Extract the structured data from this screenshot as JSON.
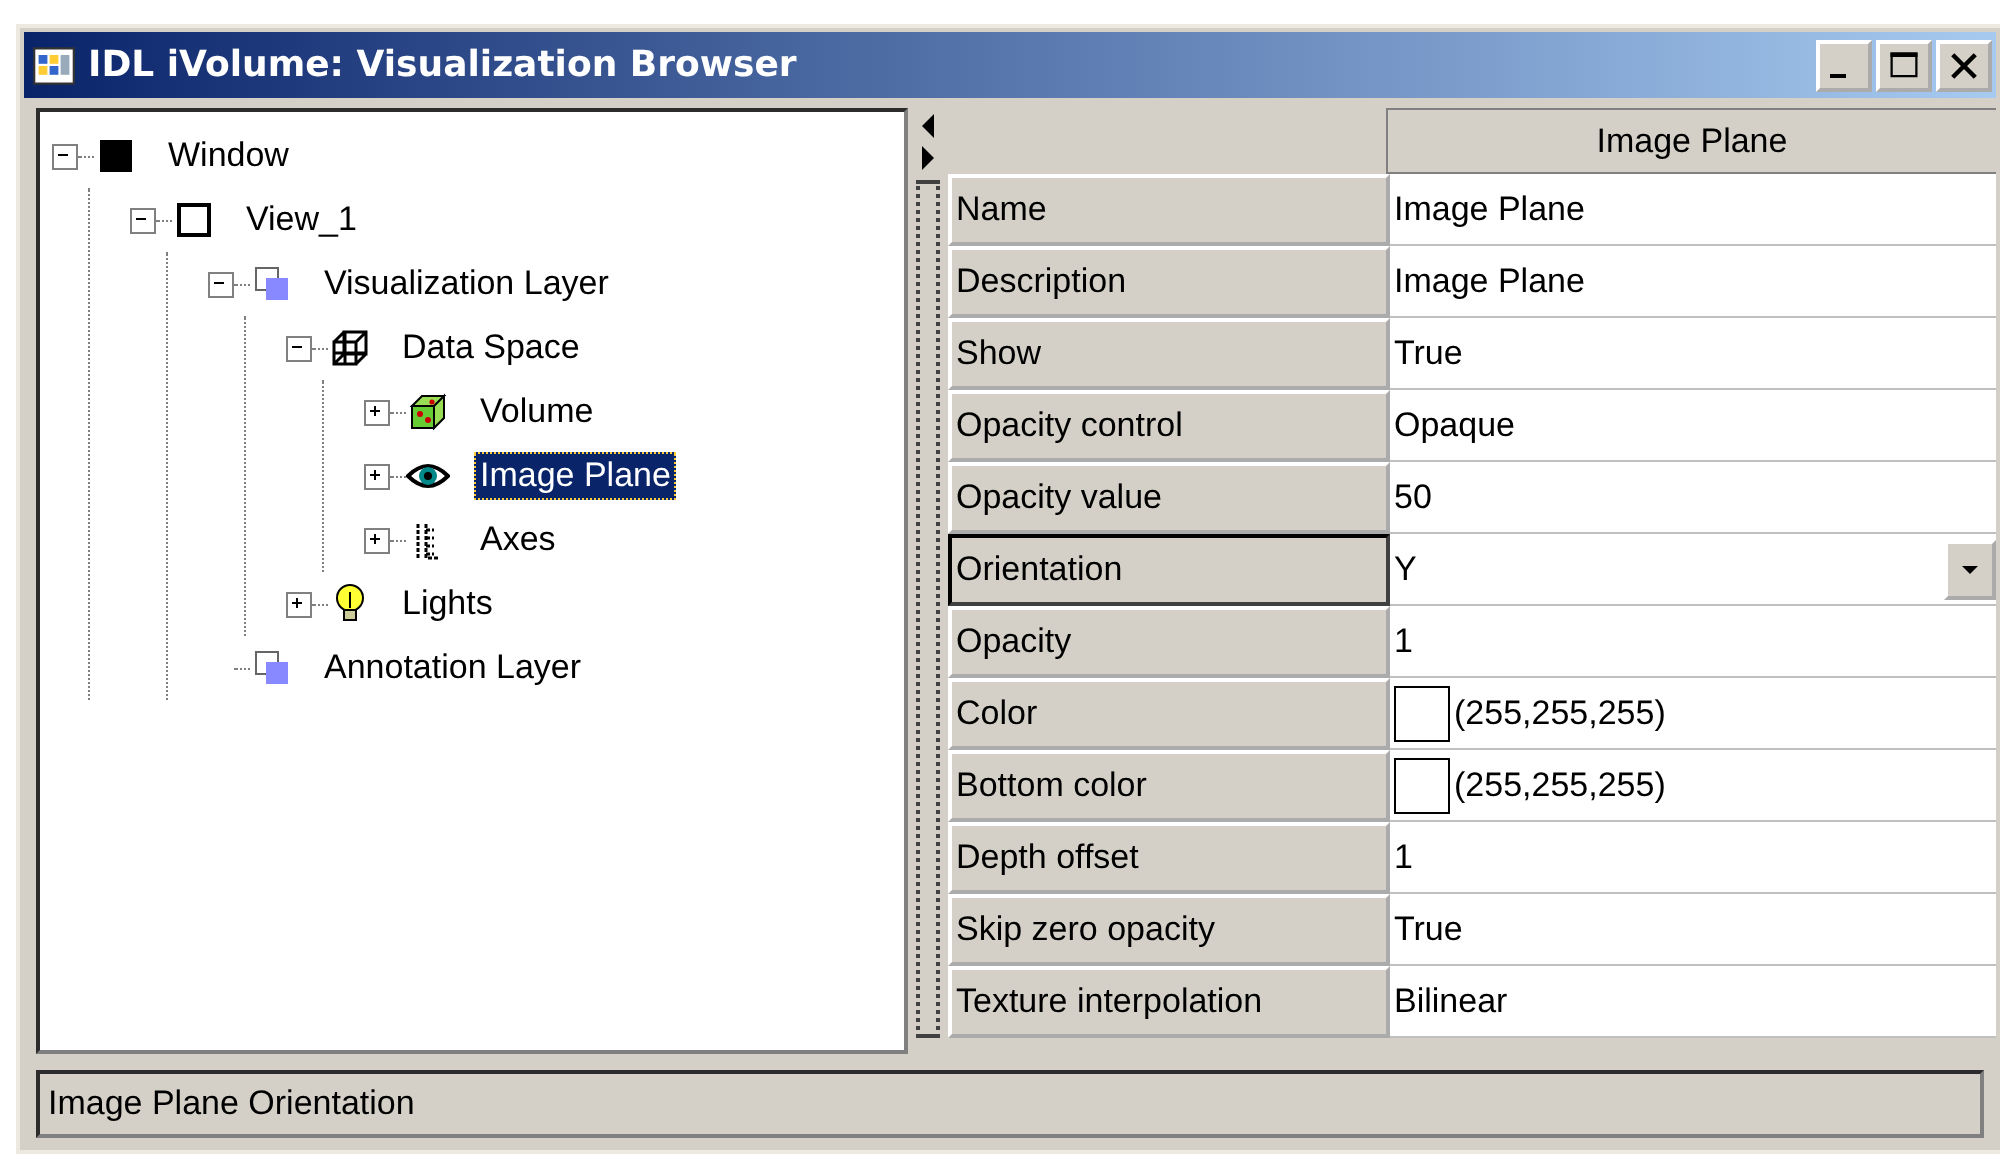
{
  "window": {
    "title": "IDL iVolume: Visualization Browser"
  },
  "tree": [
    {
      "label": "Window",
      "kind": "window",
      "expanded": true,
      "selected": false,
      "children": [
        {
          "label": "View_1",
          "kind": "view",
          "expanded": true,
          "selected": false,
          "children": [
            {
              "label": "Visualization Layer",
              "kind": "layer",
              "expanded": true,
              "selected": false,
              "children": [
                {
                  "label": "Data Space",
                  "kind": "dataspace",
                  "expanded": true,
                  "selected": false,
                  "children": [
                    {
                      "label": "Volume",
                      "kind": "volume",
                      "expanded": false,
                      "selected": false
                    },
                    {
                      "label": "Image Plane",
                      "kind": "eye",
                      "expanded": false,
                      "selected": true
                    },
                    {
                      "label": "Axes",
                      "kind": "axes",
                      "expanded": false,
                      "selected": false
                    }
                  ]
                },
                {
                  "label": "Lights",
                  "kind": "bulb",
                  "expanded": false,
                  "selected": false
                }
              ]
            },
            {
              "label": "Annotation Layer",
              "kind": "layer",
              "selected": false
            }
          ]
        }
      ]
    }
  ],
  "properties": {
    "header": "Image Plane",
    "rows": [
      {
        "name": "Name",
        "value": "Image Plane",
        "kind": "text",
        "selected": false
      },
      {
        "name": "Description",
        "value": "Image Plane",
        "kind": "text",
        "selected": false
      },
      {
        "name": "Show",
        "value": "True",
        "kind": "text",
        "selected": false
      },
      {
        "name": "Opacity control",
        "value": "Opaque",
        "kind": "text",
        "selected": false
      },
      {
        "name": "Opacity value",
        "value": "50",
        "kind": "text",
        "selected": false
      },
      {
        "name": "Orientation",
        "value": "Y",
        "kind": "dropdown",
        "selected": true
      },
      {
        "name": "Opacity",
        "value": "1",
        "kind": "text",
        "selected": false
      },
      {
        "name": "Color",
        "value": "(255,255,255)",
        "kind": "color",
        "color": "#ffffff",
        "selected": false
      },
      {
        "name": "Bottom color",
        "value": "(255,255,255)",
        "kind": "color",
        "color": "#ffffff",
        "selected": false
      },
      {
        "name": "Depth offset",
        "value": "1",
        "kind": "text",
        "selected": false
      },
      {
        "name": "Skip zero opacity",
        "value": "True",
        "kind": "text",
        "selected": false
      },
      {
        "name": "Texture interpolation",
        "value": "Bilinear",
        "kind": "text",
        "selected": false
      }
    ]
  },
  "status_bar": {
    "text": "Image Plane Orientation"
  }
}
